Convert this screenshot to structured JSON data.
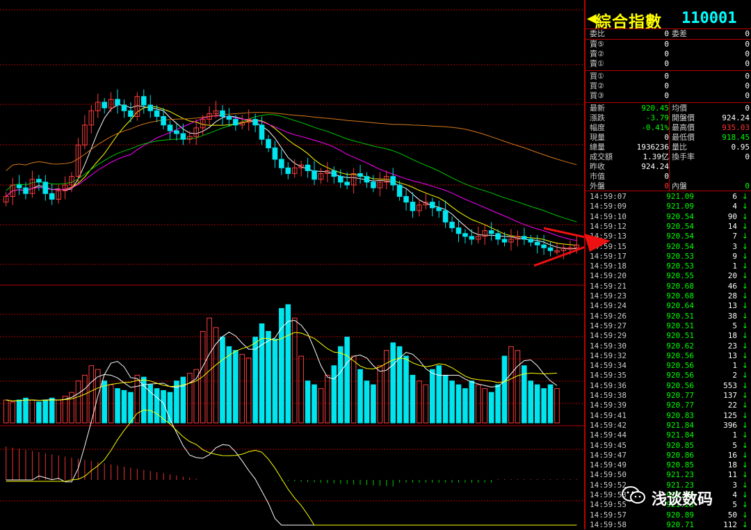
{
  "quote": {
    "name": "綜合指數",
    "code": "110001",
    "rows": [
      {
        "l": "委比",
        "v": "0",
        "r": "委差",
        "rv": "0"
      },
      {
        "l": "賣⑤",
        "v": "0",
        "rv": "0"
      },
      {
        "l": "賣②",
        "v": "0",
        "rv": "0"
      },
      {
        "l": "賣①",
        "v": "0",
        "rv": "0"
      },
      {
        "l": "買①",
        "v": "0",
        "rv": "0"
      },
      {
        "l": "買②",
        "v": "0",
        "rv": "0"
      },
      {
        "l": "買③",
        "v": "0",
        "rv": "0"
      }
    ],
    "stats": [
      {
        "l": "最新",
        "v": "920.45",
        "vc": "#0f0",
        "r": "均價",
        "rv": "0",
        "rc": "#fff"
      },
      {
        "l": "漲跌",
        "v": "-3.79",
        "vc": "#0f0",
        "r": "開盤價",
        "rv": "924.24",
        "rc": "#fff"
      },
      {
        "l": "幅度",
        "v": "-0.41%",
        "vc": "#0f0",
        "r": "最高價",
        "rv": "935.03",
        "rc": "#f33"
      },
      {
        "l": "現量",
        "v": "0",
        "vc": "#fff",
        "r": "最低價",
        "rv": "918.45",
        "rc": "#0f0"
      },
      {
        "l": "總量",
        "v": "1936236",
        "vc": "#fff",
        "r": "量比",
        "rv": "0.95",
        "rc": "#fff"
      },
      {
        "l": "成交額",
        "v": "1.39亿",
        "vc": "#fff",
        "r": "換手率",
        "rv": "0",
        "rc": "#fff"
      },
      {
        "l": "昨收",
        "v": "924.24",
        "vc": "#fff",
        "r": "",
        "rv": "",
        "rc": "#fff"
      },
      {
        "l": "市值",
        "v": "0",
        "vc": "#fff",
        "r": "",
        "rv": "",
        "rc": "#fff"
      },
      {
        "l": "外盤",
        "v": "0",
        "vc": "#f33",
        "r": "內盤",
        "rv": "0",
        "rc": "#0f0"
      }
    ],
    "ticks": [
      [
        "14:59:07",
        "921.09",
        "6"
      ],
      [
        "14:59:09",
        "921.09",
        "4"
      ],
      [
        "14:59:10",
        "920.54",
        "90"
      ],
      [
        "14:59:12",
        "920.54",
        "14"
      ],
      [
        "14:59:13",
        "920.54",
        "7"
      ],
      [
        "14:59:15",
        "920.54",
        "3"
      ],
      [
        "14:59:17",
        "920.53",
        "9"
      ],
      [
        "14:59:18",
        "920.53",
        "1"
      ],
      [
        "14:59:20",
        "920.55",
        "20"
      ],
      [
        "14:59:21",
        "920.68",
        "46"
      ],
      [
        "14:59:23",
        "920.68",
        "28"
      ],
      [
        "14:59:24",
        "920.64",
        "13"
      ],
      [
        "14:59:26",
        "920.51",
        "38"
      ],
      [
        "14:59:27",
        "920.51",
        "5"
      ],
      [
        "14:59:29",
        "920.51",
        "18"
      ],
      [
        "14:59:30",
        "920.62",
        "23"
      ],
      [
        "14:59:32",
        "920.56",
        "13"
      ],
      [
        "14:59:34",
        "920.56",
        "1"
      ],
      [
        "14:59:35",
        "920.56",
        "2"
      ],
      [
        "14:59:36",
        "920.56",
        "553"
      ],
      [
        "14:59:38",
        "920.77",
        "137"
      ],
      [
        "14:59:39",
        "920.77",
        "22"
      ],
      [
        "14:59:41",
        "920.83",
        "125"
      ],
      [
        "14:59:42",
        "921.84",
        "396"
      ],
      [
        "14:59:44",
        "921.84",
        "1"
      ],
      [
        "14:59:45",
        "920.85",
        "5"
      ],
      [
        "14:59:47",
        "920.86",
        "16"
      ],
      [
        "14:59:49",
        "920.85",
        "18"
      ],
      [
        "14:59:50",
        "921.23",
        "11"
      ],
      [
        "14:59:52",
        "921.23",
        "3"
      ],
      [
        "14:59:53",
        "921.23",
        "4"
      ],
      [
        "14:59:55",
        "921.23",
        "5"
      ],
      [
        "14:59:57",
        "920.89",
        "50"
      ],
      [
        "14:59:58",
        "920.71",
        "112"
      ]
    ],
    "tick_dir": "↓"
  },
  "watermark": "浅谈数码",
  "colors": {
    "up": "#ff3c3c",
    "down": "#00e5ee",
    "grid": "#b00000"
  },
  "chart_data": {
    "type": "candlestick",
    "closes": [
      930,
      934,
      933,
      931,
      936,
      935,
      931,
      929,
      932,
      934,
      937,
      948,
      955,
      960,
      963,
      961,
      964,
      962,
      960,
      958,
      965,
      962,
      960,
      958,
      955,
      953,
      952,
      950,
      951,
      954,
      957,
      959,
      960,
      958,
      957,
      955,
      956,
      957,
      955,
      950,
      947,
      943,
      940,
      938,
      940,
      941,
      939,
      936,
      938,
      939,
      937,
      935,
      934,
      938,
      937,
      935,
      933,
      935,
      937,
      934,
      930,
      928,
      925,
      927,
      928,
      926,
      925,
      921,
      919,
      917,
      916,
      915,
      916,
      918,
      917,
      915,
      914,
      915,
      916,
      915,
      914,
      913,
      912,
      911,
      911,
      912,
      912,
      913
    ],
    "volumes": [
      12,
      11,
      12,
      13,
      12,
      11,
      12,
      13,
      12,
      14,
      16,
      22,
      25,
      30,
      28,
      22,
      20,
      18,
      17,
      16,
      25,
      24,
      20,
      18,
      17,
      16,
      22,
      24,
      26,
      28,
      48,
      55,
      50,
      45,
      40,
      38,
      36,
      34,
      45,
      52,
      48,
      44,
      60,
      62,
      55,
      35,
      22,
      20,
      18,
      25,
      30,
      40,
      45,
      35,
      28,
      22,
      20,
      30,
      38,
      42,
      40,
      35,
      25,
      22,
      20,
      28,
      30,
      25,
      22,
      20,
      18,
      22,
      20,
      18,
      16,
      20,
      35,
      40,
      38,
      30,
      22,
      20,
      18,
      20,
      18
    ]
  }
}
